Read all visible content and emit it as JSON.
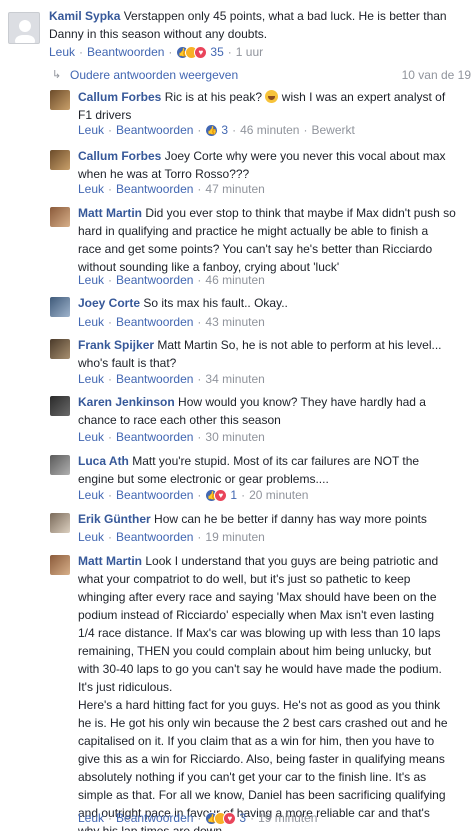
{
  "labels": {
    "like": "Leuk",
    "reply": "Beantwoorden",
    "sep": "·"
  },
  "top_comment": {
    "author": "Kamil Sypka",
    "text_lines": [
      "Verstappen only 45 points, what a bad luck. He is better than",
      "Danny in this season without any doubts."
    ],
    "reactions": "35",
    "time": "1 uur"
  },
  "older_replies": {
    "label": "Oudere antwoorden weergeven",
    "count": "10 van de 19"
  },
  "replies": [
    {
      "author": "Callum Forbes",
      "paragraphs": [
        "Ric is at his peak? [emoji] wish I was an expert analyst of F1 drivers"
      ],
      "text_before_emoji": "Ric is at his peak?",
      "text_after_emoji": "wish I was an expert analyst of",
      "line2": "F1 drivers",
      "reactions": "3",
      "time": "46 minuten",
      "edited": "Bewerkt"
    },
    {
      "author": "Callum Forbes",
      "line1": "Joey Corte why were you never this vocal about max",
      "line2": "when he was at Torro Rosso???",
      "time": "47 minuten"
    },
    {
      "author": "Matt Martin",
      "line1": "Ever stop to think that maybe if Max didn't push so",
      "line1_full": "Did you ever stop to think that maybe if Max didn't push so",
      "line2": "hard in qualifying and practice he might actually be able to finish a",
      "line3": "race and get some points? You can't say he's better than Ricciardo",
      "line4": "without sounding like a fanboy, crying about 'luck'",
      "time": "46 minuten"
    },
    {
      "author": "Joey Corte",
      "line1": "So its max his fault.. Okay..",
      "time": "43 minuten"
    },
    {
      "author": "Frank Spijker",
      "line1": "Matt Martin So, he is not able to perform at his level...",
      "line2": "who's fault is that?",
      "time": "34 minuten"
    },
    {
      "author": "Karen Jenkinson",
      "line1": "How would you know? They have hardly had a",
      "line2": "chance to race each other this season",
      "time": "30 minuten"
    },
    {
      "author": "Luca Ath",
      "line1": "Matt you're stupid. Most of its car failures are NOT the",
      "line2": "engine but some electronic or gear problems....",
      "reactions": "1",
      "time": "20 minuten"
    },
    {
      "author": "Erik Günther",
      "line1": "How can he be better if danny has way more points",
      "time": "19 minuten"
    },
    {
      "author": "Matt Martin",
      "lines": [
        "Look I understand that you guys are being patriotic and",
        "what your compatriot to do well, but it's just so pathetic to keep",
        "whinging after every race and saying 'Max should have been on the",
        "podium instead of Ricciardo' especially when Max isn't even lasting",
        "1/4 race distance. If Max's car was blowing up with less than 10 laps",
        "remaining, THEN you could complain about him being unlucky, but",
        "with 30-40 laps to go you can't say he would have made the podium.",
        "It's just ridiculous.",
        "Here's a hard hitting fact for you guys. He's not as good as you think",
        "he is. He got his only win because the 2 best cars crashed out and he",
        "capitalised on it. If you claim that as a win for him, then you have to",
        "give this as a win for Ricciardo. Also, being faster in qualifying means",
        "absolutely nothing if you can't get your car to the finish line. It's as",
        "simple as that. For all we know, Daniel has been sacrificing qualifying",
        "and outright pace in favour of having a more reliable car and that's",
        "why his lap times are down."
      ],
      "reactions": "3",
      "time": "19 minuten"
    }
  ]
}
